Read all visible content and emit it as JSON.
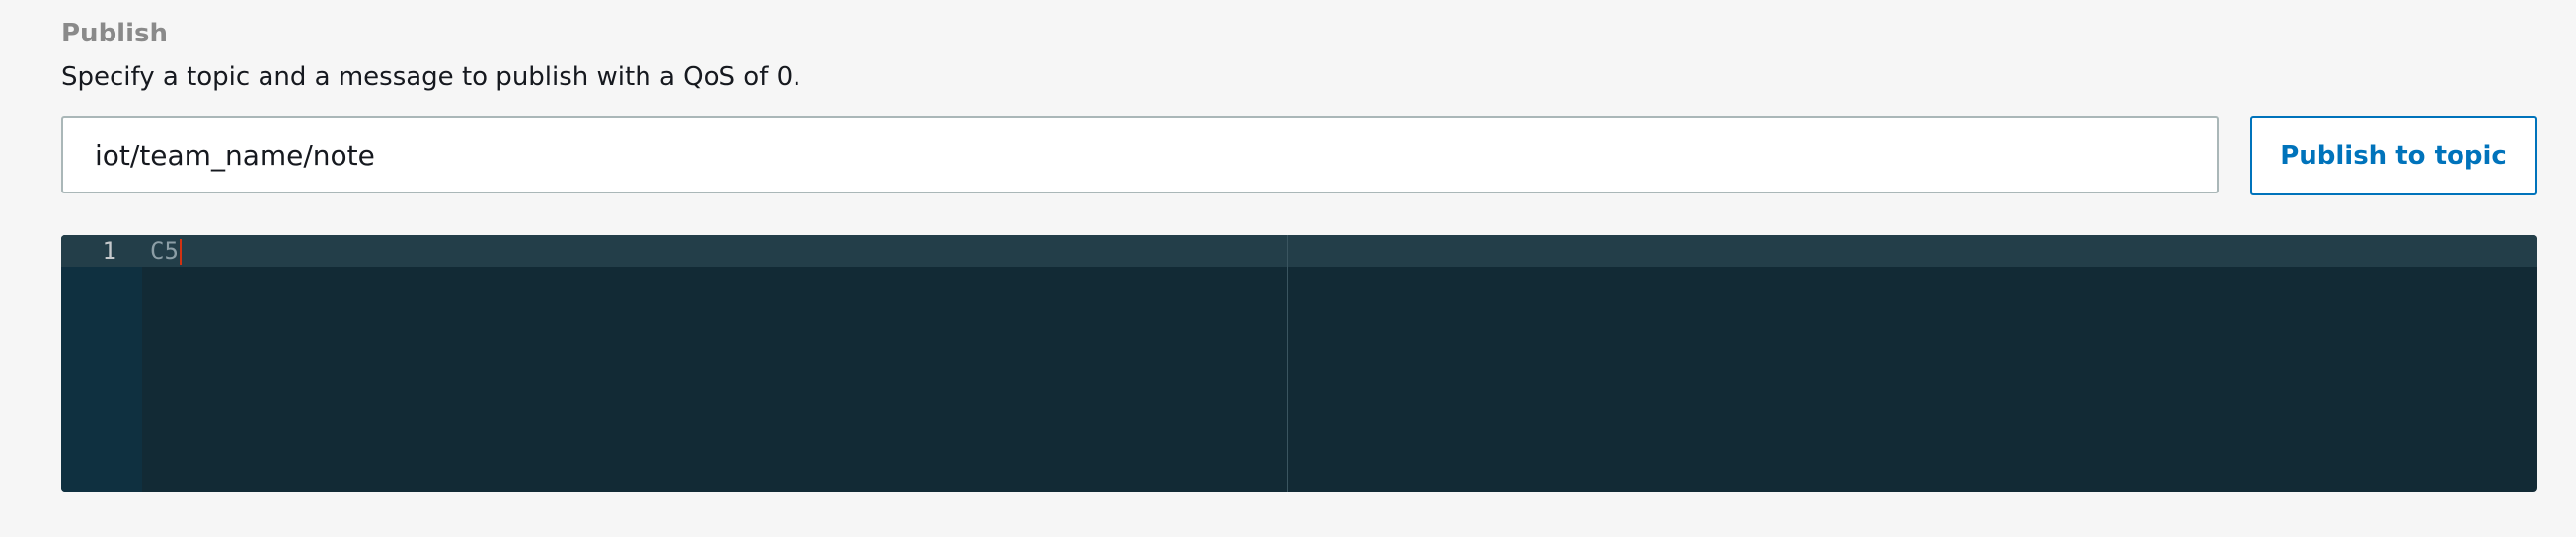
{
  "publish": {
    "title": "Publish",
    "description": "Specify a topic and a message to publish with a QoS of 0.",
    "topic_value": "iot/team_name/note",
    "button_label": "Publish to topic"
  },
  "editor": {
    "line_number": "1",
    "line_text": "C5"
  },
  "colors": {
    "accent": "#0073bb",
    "editor_background": "#122a35",
    "cursor": "#d13212"
  }
}
